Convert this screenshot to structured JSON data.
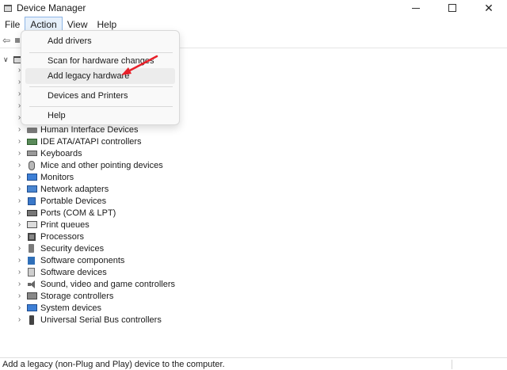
{
  "window": {
    "title": "Device Manager"
  },
  "menubar": {
    "items": [
      "File",
      "Action",
      "View",
      "Help"
    ]
  },
  "action_menu": {
    "items": [
      {
        "label": "Add drivers"
      },
      {
        "label": "Scan for hardware changes"
      },
      {
        "label": "Add legacy hardware",
        "highlighted": true
      },
      {
        "label": "Devices and Printers"
      },
      {
        "label": "Help"
      }
    ]
  },
  "tree": {
    "categories": [
      {
        "label": "Human Interface Devices",
        "icon": "hid-icon"
      },
      {
        "label": "IDE ATA/ATAPI controllers",
        "icon": "ide-controller-icon"
      },
      {
        "label": "Keyboards",
        "icon": "keyboard-icon"
      },
      {
        "label": "Mice and other pointing devices",
        "icon": "mouse-icon"
      },
      {
        "label": "Monitors",
        "icon": "monitor-icon"
      },
      {
        "label": "Network adapters",
        "icon": "network-adapter-icon"
      },
      {
        "label": "Portable Devices",
        "icon": "portable-device-icon"
      },
      {
        "label": "Ports (COM & LPT)",
        "icon": "ports-icon"
      },
      {
        "label": "Print queues",
        "icon": "printer-icon"
      },
      {
        "label": "Processors",
        "icon": "processor-icon"
      },
      {
        "label": "Security devices",
        "icon": "security-device-icon"
      },
      {
        "label": "Software components",
        "icon": "software-component-icon"
      },
      {
        "label": "Software devices",
        "icon": "software-device-icon"
      },
      {
        "label": "Sound, video and game controllers",
        "icon": "speaker-icon"
      },
      {
        "label": "Storage controllers",
        "icon": "storage-controller-icon"
      },
      {
        "label": "System devices",
        "icon": "system-device-icon"
      },
      {
        "label": "Universal Serial Bus controllers",
        "icon": "usb-icon"
      }
    ]
  },
  "statusbar": {
    "text": "Add a legacy (non-Plug and Play) device to the computer."
  },
  "colors": {
    "annotation_arrow": "#e8202a",
    "menu_active_border": "#8fb6e6"
  }
}
